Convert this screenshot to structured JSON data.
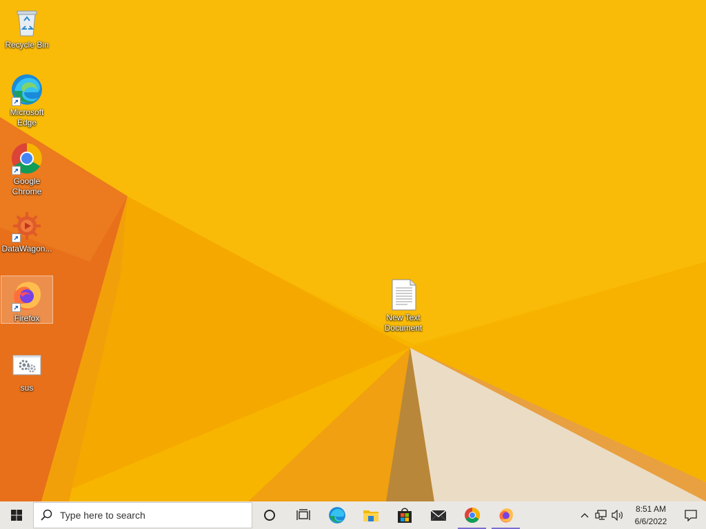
{
  "desktop": {
    "icons": [
      {
        "label": "Recycle Bin",
        "icon": "recycle-bin-icon",
        "shortcut": false
      },
      {
        "label": "Microsoft Edge",
        "icon": "edge-icon",
        "shortcut": true
      },
      {
        "label": "Google Chrome",
        "icon": "chrome-icon",
        "shortcut": true
      },
      {
        "label": "DataWagon...",
        "icon": "datawagon-icon",
        "shortcut": true
      },
      {
        "label": "Firefox",
        "icon": "firefox-icon",
        "shortcut": true,
        "selected": true
      },
      {
        "label": "sus",
        "icon": "settings-file-icon",
        "shortcut": false
      },
      {
        "label": "New Text Document",
        "icon": "text-document-icon",
        "shortcut": false
      }
    ],
    "colors": {
      "wallpaper": "#f7b500",
      "accent_orange": "#e8701a",
      "cream": "#ebdcc6"
    }
  },
  "taskbar": {
    "start_icon": "windows-logo-icon",
    "search_placeholder": "Type here to search",
    "pinned": [
      {
        "name": "cortana",
        "icon": "circle-icon"
      },
      {
        "name": "task-view",
        "icon": "task-view-icon"
      },
      {
        "name": "edge",
        "icon": "edge-icon"
      },
      {
        "name": "file-explorer",
        "icon": "folder-icon"
      },
      {
        "name": "store",
        "icon": "store-icon"
      },
      {
        "name": "mail",
        "icon": "mail-icon"
      },
      {
        "name": "chrome",
        "icon": "chrome-icon",
        "running": true
      },
      {
        "name": "firefox",
        "icon": "firefox-icon",
        "running": true
      }
    ],
    "tray": {
      "icons": [
        "chevron-up-icon",
        "network-icon",
        "volume-icon"
      ],
      "time": "8:51 AM",
      "date": "6/6/2022",
      "notification_icon": "notification-icon"
    }
  }
}
